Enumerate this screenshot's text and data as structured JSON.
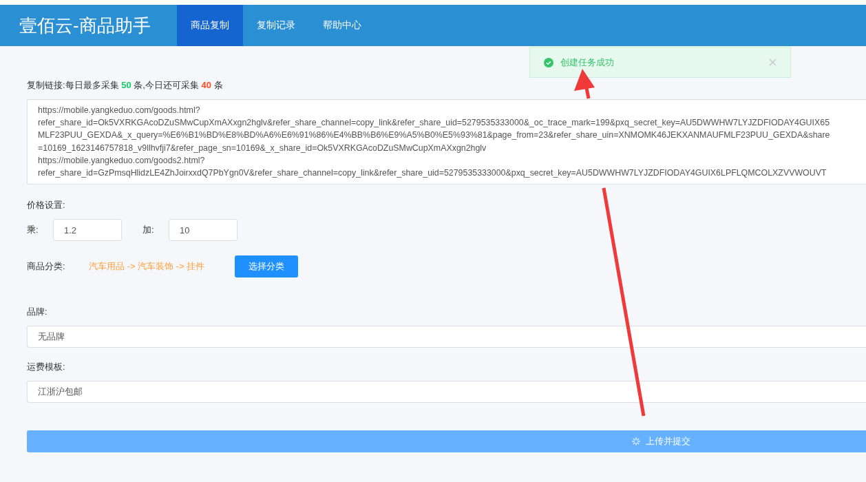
{
  "header": {
    "logo": "壹佰云-商品助手",
    "tabs": [
      {
        "label": "商品复制",
        "selected": true
      },
      {
        "label": "复制记录",
        "selected": false
      },
      {
        "label": "帮助中心",
        "selected": false
      }
    ]
  },
  "toast": {
    "kind": "success",
    "message": "创建任务成功"
  },
  "links": {
    "label": {
      "prefix": "复制链接:每日最多采集",
      "max": "50",
      "middle": "条,今日还可采集",
      "remaining": "40",
      "suffix": "条"
    },
    "lines": [
      "https://mobile.yangkeduo.com/goods.html?",
      "refer_share_id=Ok5VXRKGAcoDZuSMwCupXmAXxgn2hglv&refer_share_channel=copy_link&refer_share_uid=5279535333000&_oc_trace_mark=199&pxq_secret_key=AU5DWWHW7LYJZDFIODAY4GUIX65",
      "MLF23PUU_GEXDA&_x_query=%E6%B1%BD%E8%BD%A6%E6%91%86%E4%BB%B6%E9%A5%B0%E5%93%81&page_from=23&refer_share_uin=XNMOMK46JEKXANMAUFMLF23PUU_GEXDA&share",
      "=10169_1623146757818_v9llhvfji7&refer_page_sn=10169&_x_share_id=Ok5VXRKGAcoDZuSMwCupXmAXxgn2hglv",
      "https://mobile.yangkeduo.com/goods2.html?",
      "refer_share_id=GzPmsqHlidzLE4ZhJoirxxdQ7PbYgn0V&refer_share_channel=copy_link&refer_share_uid=5279535333000&pxq_secret_key=AU5DWWHW7LYJZDFIODAY4GUIX6LPFLQMCOLXZVVWOUVT"
    ]
  },
  "price": {
    "title": "价格设置:",
    "fields": [
      {
        "label": "乘:",
        "value": "1.2"
      },
      {
        "label": "加:",
        "value": "10"
      }
    ]
  },
  "category": {
    "label": "商品分类:",
    "path": "汽车用品 -> 汽车装饰 -> 挂件",
    "button": "选择分类"
  },
  "brand": {
    "label": "品牌:",
    "value": "无品牌"
  },
  "shipping": {
    "label": "运费模板:",
    "value": "江浙沪包邮"
  },
  "submit": {
    "label": "上传并提交",
    "loading": true
  }
}
